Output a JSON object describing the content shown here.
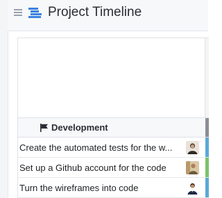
{
  "header": {
    "title": "Project Timeline",
    "menu_icon": "hamburger-icon",
    "title_icon": "timeline-icon",
    "accent": "#3b82e0"
  },
  "section": {
    "label": "Development",
    "icon": "flag-icon",
    "bar_color": "#8a8f96"
  },
  "tasks": [
    {
      "name": "Create the automated tests for the w...",
      "avatar": "avatar-person-1",
      "status_color": "#5aa9d6"
    },
    {
      "name": "Set up a Github account for the code",
      "avatar": "avatar-person-2",
      "status_color": "#7cc26a"
    },
    {
      "name": "Turn the wireframes into code",
      "avatar": "avatar-person-3",
      "status_color": "#5aa9d6"
    }
  ]
}
